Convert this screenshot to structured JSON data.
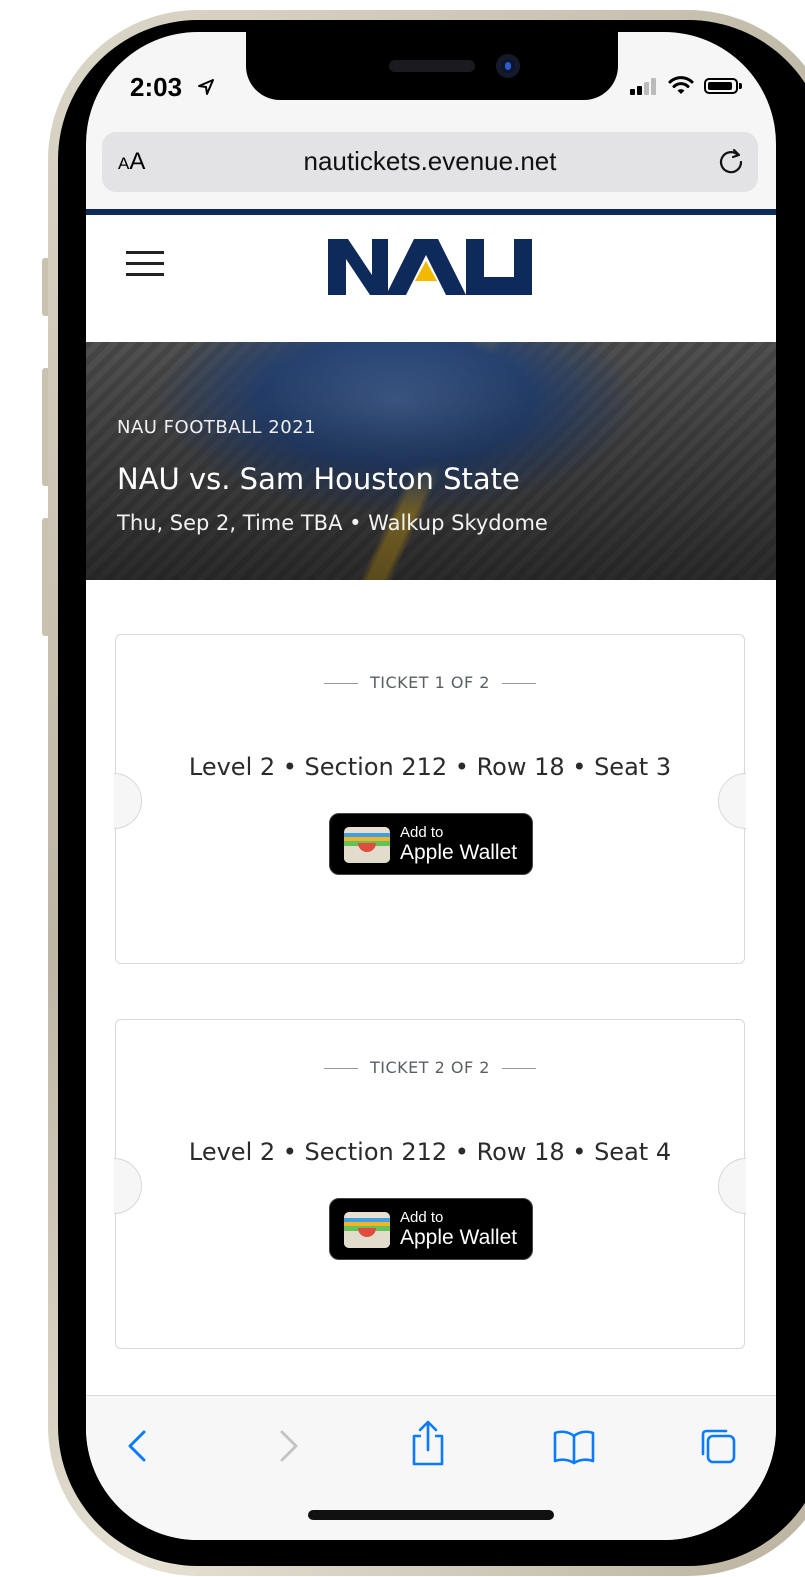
{
  "status_bar": {
    "time": "2:03"
  },
  "browser": {
    "aa_label_small": "A",
    "aa_label_large": "A",
    "url": "nautickets.evenue.net"
  },
  "site": {
    "logo_text": "NAU",
    "colors": {
      "navy": "#0e2a5a",
      "gold": "#f2b900",
      "ios_blue": "#0a7aff"
    }
  },
  "event": {
    "kicker": "NAU FOOTBALL 2021",
    "title": "NAU vs. Sam Houston State",
    "subtitle": "Thu, Sep 2, Time TBA • Walkup Skydome"
  },
  "tickets": [
    {
      "label": "TICKET 1 OF 2",
      "seat": "Level 2 • Section 212 • Row 18 • Seat 3",
      "wallet_small": "Add to",
      "wallet_big": "Apple Wallet"
    },
    {
      "label": "TICKET 2 OF 2",
      "seat": "Level 2 • Section 212 • Row 18 • Seat 4",
      "wallet_small": "Add to",
      "wallet_big": "Apple Wallet"
    }
  ],
  "toolbar": {
    "icons": [
      "back-icon",
      "forward-icon",
      "share-icon",
      "bookmarks-icon",
      "tabs-icon"
    ]
  }
}
